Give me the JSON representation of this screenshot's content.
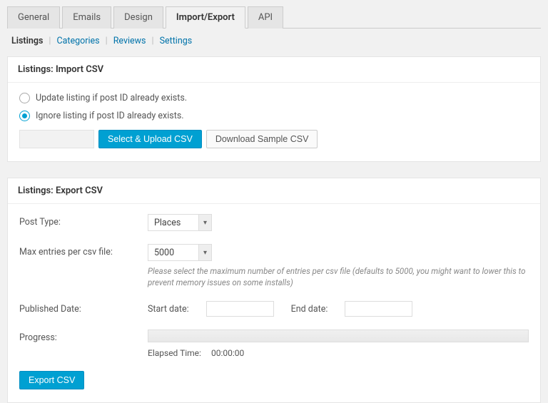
{
  "mainTabs": {
    "t0": "General",
    "t1": "Emails",
    "t2": "Design",
    "t3": "Import/Export",
    "t4": "API"
  },
  "subTabs": {
    "s0": "Listings",
    "s1": "Categories",
    "s2": "Reviews",
    "s3": "Settings"
  },
  "importPanel": {
    "title": "Listings: Import CSV",
    "opt_update": "Update listing if post ID already exists.",
    "opt_ignore": "Ignore listing if post ID already exists.",
    "btn_upload": "Select & Upload CSV",
    "btn_sample": "Download Sample CSV"
  },
  "exportPanel": {
    "title": "Listings: Export CSV",
    "postType_label": "Post Type:",
    "postType_value": "Places",
    "maxEntries_label": "Max entries per csv file:",
    "maxEntries_value": "5000",
    "maxEntries_help": "Please select the maximum number of entries per csv file (defaults to 5000, you might want to lower this to prevent memory issues on some installs)",
    "pubDate_label": "Published Date:",
    "startDate_label": "Start date:",
    "endDate_label": "End date:",
    "progress_label": "Progress:",
    "elapsed_label": "Elapsed Time:",
    "elapsed_value": "00:00:00",
    "btn_export": "Export CSV"
  }
}
